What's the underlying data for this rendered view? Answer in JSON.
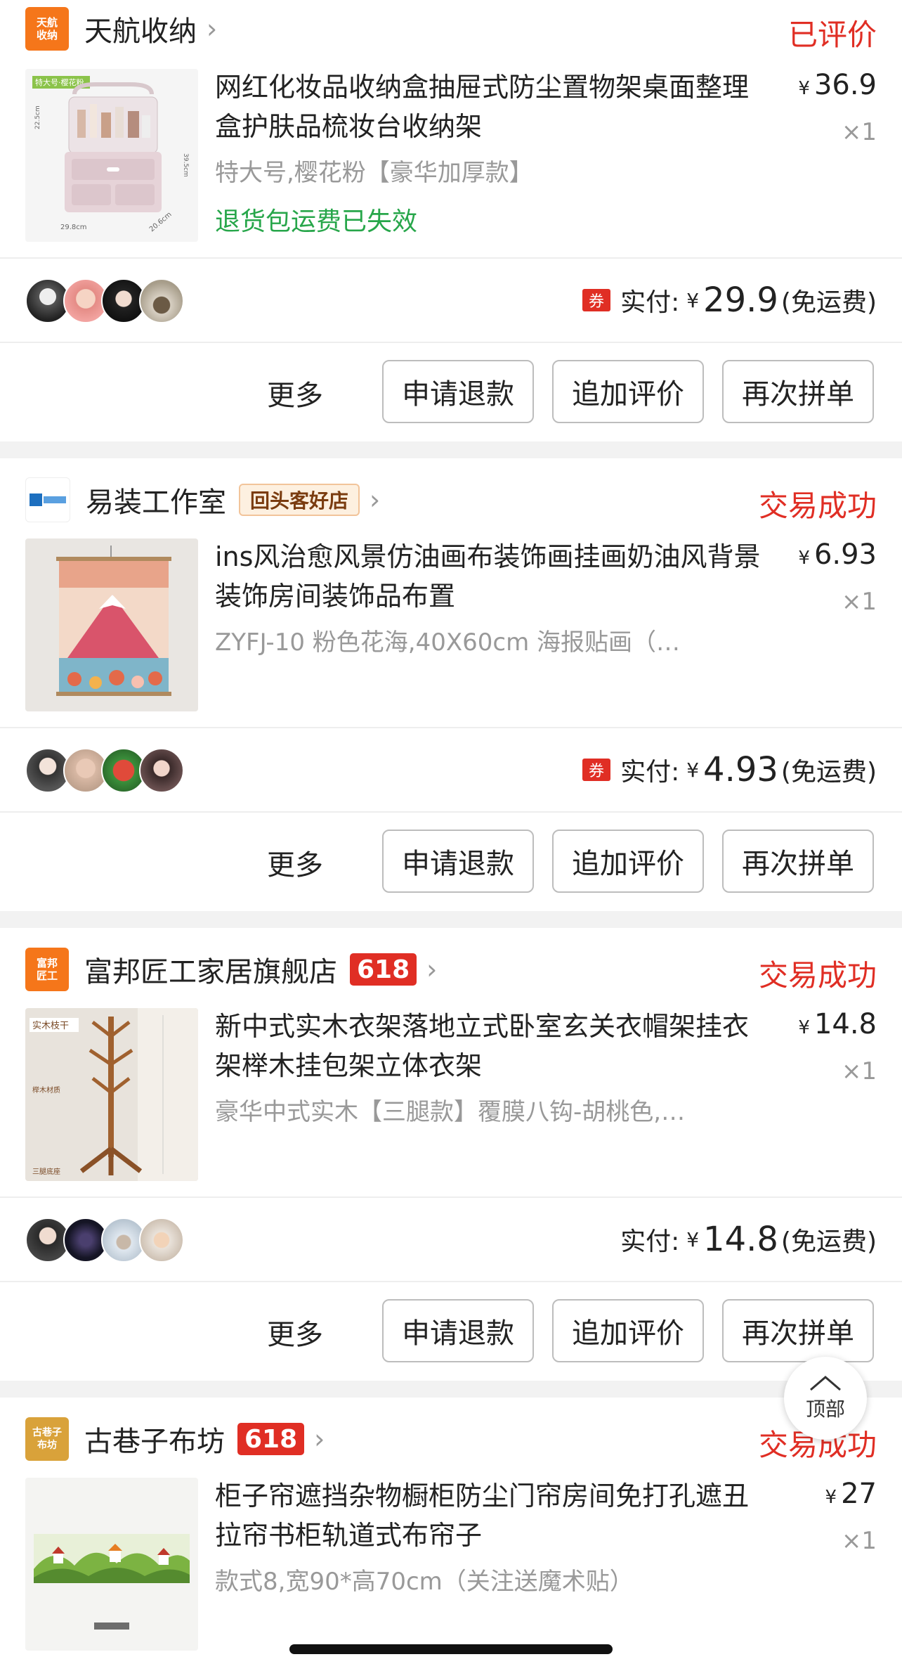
{
  "orders": [
    {
      "shop_logo_text": "天航\n收纳",
      "shop_logo_color": "#f5761a",
      "shop_name": "天航收纳",
      "status": "已评价",
      "title": "网红化妆品收纳盒抽屉式防尘置物架桌面整理盒护肤品梳妆台收纳架",
      "price": "36.9",
      "currency": "¥",
      "qty": "×1",
      "spec": "特大号,樱花粉【豪华加厚款】",
      "refund_note": "退货包运费已失效",
      "coupon": "券",
      "paid_label": "实付:",
      "paid_amount": "29.9",
      "shipping_note": "(免运费)",
      "image_label_top": "特大号·樱花粉",
      "image_dim_h": "22.5cm",
      "image_dim_total": "39.5cm",
      "image_dim_w": "29.8cm",
      "image_dim_d": "20.6cm"
    },
    {
      "shop_logo_text": "易装工作室",
      "shop_logo_color": "#ffffff",
      "shop_name": "易装工作室",
      "shop_badge": "回头客好店",
      "status": "交易成功",
      "title": "ins风治愈风景仿油画布装饰画挂画奶油风背景装饰房间装饰品布置",
      "price": "6.93",
      "currency": "¥",
      "qty": "×1",
      "spec": "ZYFJ-10 粉色花海,40X60cm 海报贴画（…",
      "coupon": "券",
      "paid_label": "实付:",
      "paid_amount": "4.93",
      "shipping_note": "(免运费)"
    },
    {
      "shop_logo_text": "富邦\n匠工",
      "shop_logo_color": "#f5761a",
      "shop_name": "富邦匠工家居旗舰店",
      "shop_badge": "618",
      "status": "交易成功",
      "title": "新中式实木衣架落地立式卧室玄关衣帽架挂衣架榉木挂包架立体衣架",
      "price": "14.8",
      "currency": "¥",
      "qty": "×1",
      "spec": "豪华中式实木【三腿款】覆膜八钩-胡桃色,…",
      "paid_label": "实付:",
      "paid_amount": "14.8",
      "shipping_note": "(免运费)",
      "image_label_top": "实木枝干",
      "image_label_mid": "榉木材质",
      "image_label_bottom": "三腿底座"
    },
    {
      "shop_logo_text": "古巷子\n布坊",
      "shop_logo_color": "#d9a23a",
      "shop_name": "古巷子布坊",
      "shop_badge": "618",
      "status": "交易成功",
      "title": "柜子帘遮挡杂物橱柜防尘门帘房间免打孔遮丑拉帘书柜轨道式布帘子",
      "price": "27",
      "currency": "¥",
      "qty": "×1",
      "spec": "款式8,宽90*高70cm（关注送魔术贴）"
    }
  ],
  "actions": {
    "more": "更多",
    "refund": "申请退款",
    "add_review": "追加评价",
    "rebuy": "再次拼单"
  },
  "back_to_top": "顶部"
}
